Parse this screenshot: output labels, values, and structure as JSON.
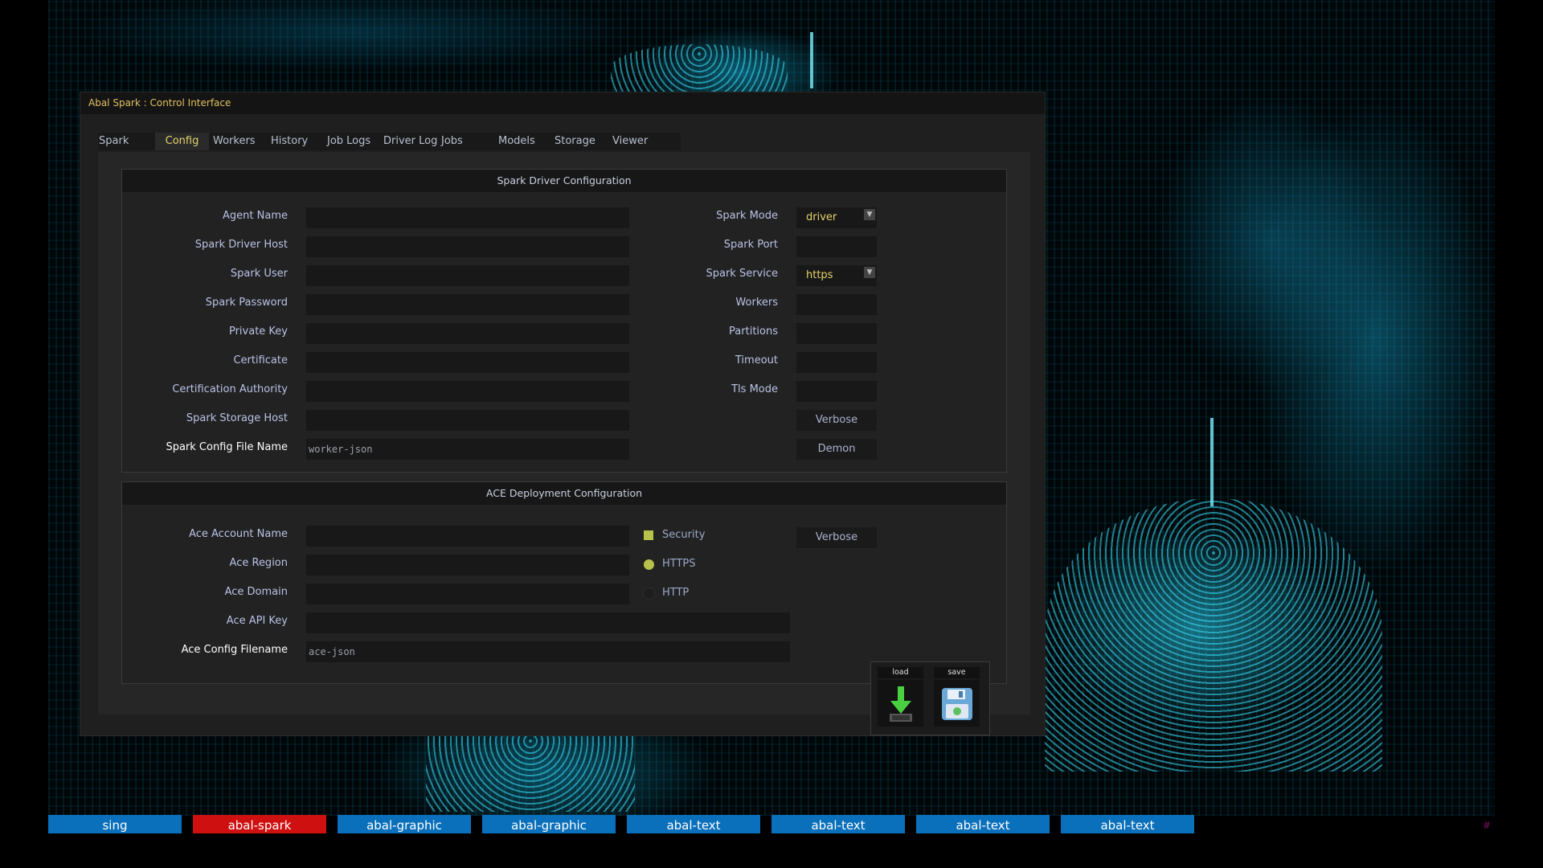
{
  "window": {
    "title": "Abal Spark : Control Interface"
  },
  "tabs": [
    {
      "label": "Spark",
      "active": false
    },
    {
      "label": "Config",
      "active": true
    },
    {
      "label": "Workers",
      "active": false
    },
    {
      "label": "History",
      "active": false
    },
    {
      "label": "Job Logs",
      "active": false
    },
    {
      "label": "Driver Log",
      "active": false
    },
    {
      "label": "Jobs",
      "active": false
    },
    {
      "label": "Models",
      "active": false
    },
    {
      "label": "Storage",
      "active": false
    },
    {
      "label": "Viewer",
      "active": false
    }
  ],
  "driver_panel": {
    "header": "Spark Driver Configuration",
    "left_fields": [
      {
        "label": "Agent Name",
        "value": ""
      },
      {
        "label": "Spark Driver Host",
        "value": ""
      },
      {
        "label": "Spark User",
        "value": ""
      },
      {
        "label": "Spark Password",
        "value": ""
      },
      {
        "label": "Private Key",
        "value": ""
      },
      {
        "label": "Certificate",
        "value": ""
      },
      {
        "label": "Certification Authority",
        "value": ""
      },
      {
        "label": "Spark Storage Host",
        "value": ""
      },
      {
        "label": "Spark Config File Name",
        "value": "worker-json"
      }
    ],
    "right_fields": [
      {
        "label": "Spark Mode",
        "value": "driver",
        "type": "select"
      },
      {
        "label": "Spark Port",
        "value": ""
      },
      {
        "label": "Spark Service",
        "value": "https",
        "type": "select"
      },
      {
        "label": "Workers",
        "value": ""
      },
      {
        "label": "Partitions",
        "value": ""
      },
      {
        "label": "Timeout",
        "value": ""
      },
      {
        "label": "Tls Mode",
        "value": ""
      }
    ],
    "buttons": {
      "verbose": "Verbose",
      "demon": "Demon"
    }
  },
  "ace_panel": {
    "header": "ACE Deployment Configuration",
    "fields": [
      {
        "label": "Ace Account Name",
        "value": ""
      },
      {
        "label": "Ace Region",
        "value": ""
      },
      {
        "label": "Ace Domain",
        "value": ""
      },
      {
        "label": "Ace API Key",
        "value": ""
      },
      {
        "label": "Ace Config Filename",
        "value": "ace-json"
      }
    ],
    "options": {
      "security": {
        "label": "Security",
        "checked": true
      },
      "https": {
        "label": "HTTPS",
        "selected": true
      },
      "http": {
        "label": "HTTP",
        "selected": false
      }
    },
    "verbose": "Verbose",
    "load_label": "load",
    "save_label": "save"
  },
  "taskbar": [
    {
      "label": "sing",
      "active": false
    },
    {
      "label": "abal-spark",
      "active": true
    },
    {
      "label": "abal-graphic",
      "active": false
    },
    {
      "label": "abal-graphic",
      "active": false
    },
    {
      "label": "abal-text",
      "active": false
    },
    {
      "label": "abal-text",
      "active": false
    },
    {
      "label": "abal-text",
      "active": false
    },
    {
      "label": "abal-text",
      "active": false
    }
  ],
  "corner_mark": "#",
  "colors": {
    "accent_text": "#e6d36a",
    "label_text": "#b9c3e6",
    "taskbar_blue": "#0a70bb",
    "taskbar_active": "#cf1010",
    "option_green": "#b7c24a"
  }
}
